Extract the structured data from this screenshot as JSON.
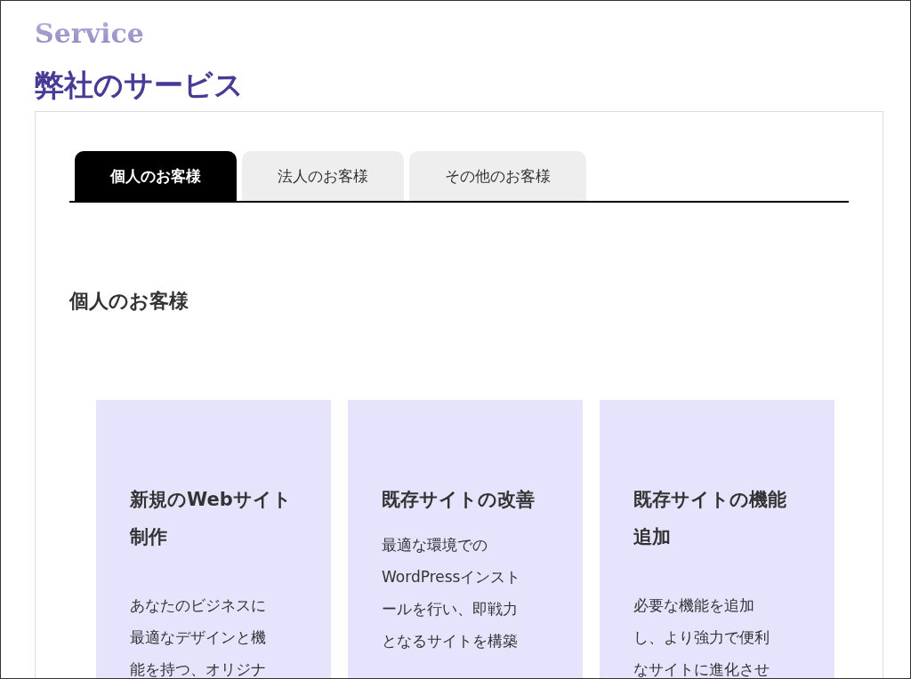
{
  "logo": "Service",
  "page_title": "弊社のサービス",
  "tabs": [
    {
      "label": "個人のお客様",
      "selected": true
    },
    {
      "label": "法人のお客様",
      "selected": false
    },
    {
      "label": "その他のお客様",
      "selected": false
    }
  ],
  "section_heading": "個人のお客様",
  "cards": [
    {
      "title": "新規のWebサイト制作",
      "body": "あなたのビジネスに最適なデザインと機能を持つ、オリジナ"
    },
    {
      "title": "既存サイトの改善",
      "body": "最適な環境でのWordPressインストールを行い、即戦力となるサイトを構築"
    },
    {
      "title": "既存サイトの機能追加",
      "body": "必要な機能を追加し、より強力で便利なサイトに進化させ"
    }
  ]
}
